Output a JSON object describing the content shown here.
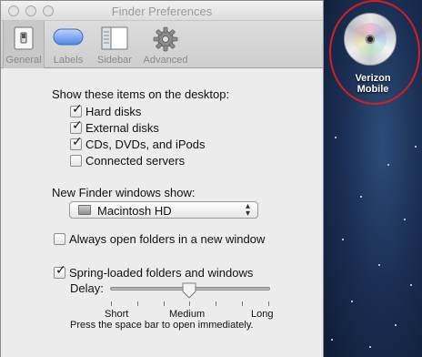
{
  "window": {
    "title": "Finder Preferences"
  },
  "toolbar": {
    "tabs": [
      {
        "label": "General",
        "icon": "general-switch-icon",
        "selected": true
      },
      {
        "label": "Labels",
        "icon": "label-capsule-icon",
        "selected": false
      },
      {
        "label": "Sidebar",
        "icon": "sidebar-window-icon",
        "selected": false
      },
      {
        "label": "Advanced",
        "icon": "gear-icon",
        "selected": false
      }
    ]
  },
  "general": {
    "desktop_heading": "Show these items on the desktop:",
    "desktop_items": [
      {
        "label": "Hard disks",
        "checked": true
      },
      {
        "label": "External disks",
        "checked": true
      },
      {
        "label": "CDs, DVDs, and iPods",
        "checked": true
      },
      {
        "label": "Connected servers",
        "checked": false
      }
    ],
    "new_window_heading": "New Finder windows show:",
    "new_window_value": "Macintosh HD",
    "always_open_label": "Always open folders in a new window",
    "always_open_checked": false,
    "spring_label": "Spring-loaded folders and windows",
    "spring_checked": true,
    "delay_label": "Delay:",
    "delay_value": 0.5,
    "delay_short": "Short",
    "delay_medium": "Medium",
    "delay_long": "Long",
    "hint": "Press the space bar to open immediately."
  },
  "desktop": {
    "disc_label_line1": "Verizon",
    "disc_label_line2": "Mobile",
    "highlight_color": "#d81d1d"
  }
}
